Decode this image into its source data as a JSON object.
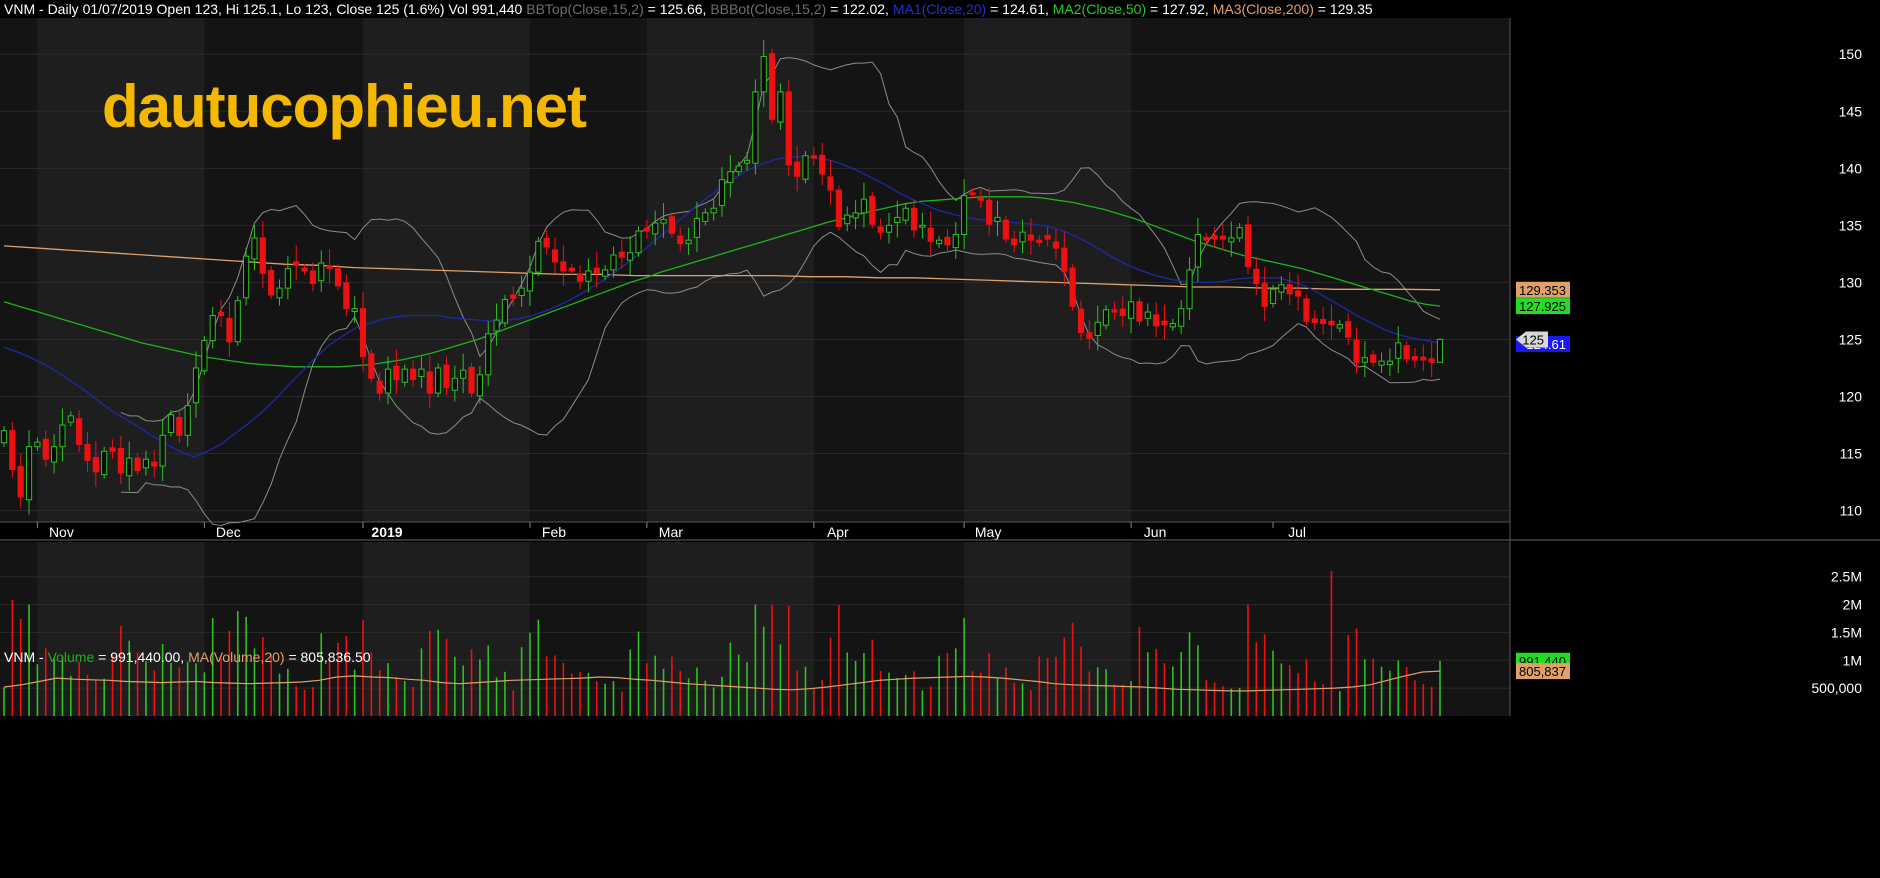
{
  "header": {
    "symbol": "VNM - ",
    "ohlc": "Daily 01/07/2019 Open 123, Hi 125.1, Lo 123, Close 125 (1.6%) Vol 991,440 ",
    "bbtop_label": "BBTop(Close,15,2)",
    "bbtop_value": " = 125.66, ",
    "bbbot_label": "BBBot(Close,15,2)",
    "bbbot_value": " = 122.02, ",
    "ma1_label": "MA1(Close,20)",
    "ma1_value": " = 124.61, ",
    "ma2_label": "MA2(Close,50)",
    "ma2_value": " = 127.92, ",
    "ma3_label": "MA3(Close,200)",
    "ma3_value": " = 129.35"
  },
  "volume_header": {
    "symbol": "VNM - ",
    "vol_label": "Volume",
    "vol_value": " = 991,440.00, ",
    "ma_label": "MA(Volume,20)",
    "ma_value": " = 805,836.50"
  },
  "watermark": "dautucophieu.net",
  "colors": {
    "background": "#000000",
    "panel_dark": "#141414",
    "panel_light": "#1e1e1e",
    "grid": "#2a2a2a",
    "up": "#2cc21f",
    "down": "#ee1111",
    "bollinger": "#8c8c8c",
    "ma20": "#1c2aa8",
    "ma50": "#1fb21f",
    "ma200": "#e0a06a",
    "watermark": "#f5b800",
    "header_gray": "#6e6e6e"
  },
  "chart_data": [
    {
      "type": "candlestick",
      "title": "VNM - Daily 01/07/2019 Open 123, Hi 125.1, Lo 123, Close 125 (1.6%) Vol 991,440",
      "ylim": [
        109,
        153
      ],
      "y_ticks": [
        110,
        115,
        120,
        125,
        130,
        135,
        140,
        145,
        150
      ],
      "x_ticks": [
        "Nov",
        "Dec",
        "2019",
        "Feb",
        "Mar",
        "Apr",
        "May",
        "Jun",
        "Jul"
      ],
      "x_tick_index": [
        4,
        24,
        43,
        63,
        77,
        97,
        115,
        135,
        152
      ],
      "closes": [
        117,
        113.6,
        111.2,
        115.6,
        116,
        114.5,
        115.6,
        117.5,
        118.3,
        115.8,
        114.4,
        113.4,
        115.2,
        115.2,
        113.3,
        114.6,
        113.5,
        114.5,
        113.9,
        116.6,
        118.4,
        116.6,
        119.2,
        122.5,
        124.9,
        127.1,
        127.1,
        124.8,
        128.4,
        132.3,
        133.9,
        130.8,
        128.9,
        129.5,
        131.2,
        131.5,
        131,
        129.9,
        131.7,
        131.2,
        129.7,
        127.7,
        127.7,
        123.5,
        121.6,
        120.3,
        122.4,
        121.5,
        122.4,
        121.5,
        122.4,
        120.3,
        122.5,
        120.8,
        121.6,
        122.3,
        120.3,
        121.9,
        125.5,
        126.7,
        128.5,
        128.6,
        129.5,
        130.9,
        133.6,
        133.1,
        131.8,
        131,
        131,
        130.1,
        131,
        130.8,
        131.1,
        132.4,
        132.2,
        132.6,
        134.5,
        134.5,
        135.2,
        135.5,
        134.3,
        133.4,
        133.7,
        135.6,
        136.1,
        136.5,
        139,
        139.7,
        140.2,
        140.7,
        146.7,
        149.8,
        144.3,
        146.7,
        140.3,
        139.3,
        141.1,
        140.9,
        139.5,
        138.1,
        134.9,
        135.9,
        136.1,
        137.3,
        135.1,
        134.4,
        135,
        135.7,
        136.5,
        134.6,
        135,
        133.6,
        133.7,
        133.3,
        134.2,
        137.6,
        137.7,
        137.2,
        135.1,
        135.7,
        133.8,
        133.3,
        134.4,
        133.7,
        133.5,
        133.8,
        133,
        131,
        127.9,
        125.6,
        125.1,
        126.5,
        127.6,
        127.4,
        127.1,
        128.3,
        126.6,
        127.4,
        126.2,
        126.3,
        126.4,
        127.7,
        131.1,
        134.2,
        133.7,
        133.8,
        133.8,
        133.9,
        134.8,
        131.4,
        129.9,
        127.9,
        129.4,
        129.8,
        129,
        128.8,
        126.6,
        126.5,
        126.4,
        126.3,
        126.3,
        125.2,
        123,
        123.4,
        123,
        123.1,
        123.1,
        124.7,
        123.3,
        123.2,
        123.2,
        123,
        125
      ],
      "ma20": [
        124.3,
        123.9,
        123.4,
        122.8,
        122.1,
        121.3,
        120.5,
        119.6,
        118.7,
        118,
        117.3,
        116.5,
        115.8,
        115.2,
        114.7,
        115.2,
        115.8,
        116.7,
        117.6,
        118.6,
        119.7,
        121,
        122.2,
        123.4,
        124.5,
        125.3,
        126,
        126.4,
        126.8,
        127,
        127.1,
        127.1,
        127.1,
        126.9,
        126.8,
        126.7,
        126.6,
        126.7,
        126.8,
        127.1,
        127.5,
        128,
        128.6,
        129.3,
        130,
        130.8,
        131.7,
        132.6,
        133.6,
        134.6,
        135.6,
        136.6,
        137.5,
        138.4,
        139.2,
        139.9,
        140.4,
        140.8,
        141,
        141,
        140.9,
        140.7,
        140.3,
        139.8,
        139.2,
        138.6,
        137.9,
        137.3,
        136.8,
        136.3,
        136,
        135.7,
        135.5,
        135.4,
        135.3,
        135.2,
        135.1,
        134.9,
        134.6,
        134.1,
        133.5,
        132.8,
        132.1,
        131.5,
        131,
        130.6,
        130.3,
        130.1,
        130,
        130,
        130.1,
        130.3,
        130.4,
        130.4,
        130.4,
        130.1,
        129.7,
        129.1,
        128.4,
        127.7,
        127,
        126.4,
        125.8,
        125.4,
        125.1,
        124.9,
        124.7
      ],
      "ma50": [
        128.3,
        127.9,
        127.5,
        127.1,
        126.7,
        126.3,
        125.9,
        125.5,
        125.1,
        124.7,
        124.4,
        124.1,
        123.8,
        123.5,
        123.3,
        123.1,
        122.9,
        122.8,
        122.7,
        122.6,
        122.6,
        122.6,
        122.6,
        122.7,
        122.8,
        123,
        123.2,
        123.5,
        123.8,
        124.2,
        124.6,
        125,
        125.5,
        126,
        126.5,
        127,
        127.5,
        128,
        128.5,
        129,
        129.5,
        130,
        130.4,
        130.9,
        131.3,
        131.7,
        132.1,
        132.5,
        132.9,
        133.3,
        133.7,
        134.1,
        134.5,
        134.9,
        135.3,
        135.6,
        136,
        136.3,
        136.6,
        136.9,
        137.1,
        137.2,
        137.3,
        137.4,
        137.5,
        137.5,
        137.5,
        137.5,
        137.4,
        137.2,
        137,
        136.7,
        136.4,
        136,
        135.6,
        135.1,
        134.6,
        134.1,
        133.6,
        133.2,
        132.8,
        132.4,
        132.1,
        131.8,
        131.5,
        131.2,
        130.8,
        130.4,
        130,
        129.6,
        129.2,
        128.8,
        128.4,
        128.1,
        127.92
      ],
      "ma200": [
        133.2,
        133,
        132.8,
        132.6,
        132.4,
        132.2,
        132,
        131.8,
        131.6,
        131.5,
        131.3,
        131.2,
        131.1,
        131,
        130.9,
        130.8,
        130.7,
        130.7,
        130.6,
        130.6,
        130.6,
        130.6,
        130.6,
        130.5,
        130.5,
        130.4,
        130.4,
        130.3,
        130.2,
        130.1,
        130,
        129.9,
        129.8,
        129.7,
        129.6,
        129.6,
        129.5,
        129.5,
        129.4,
        129.4,
        129.4,
        129.35
      ],
      "last_labels": {
        "close": "125",
        "ma200": "129.353",
        "ma50": "127.925",
        "ma20": "124.61"
      }
    },
    {
      "type": "bar",
      "title": "VNM - Volume = 991,440.00, MA(Volume,20) = 805,836.50",
      "ylim": [
        0,
        2800000
      ],
      "y_ticks": [
        "500,000",
        "1M",
        "1.5M",
        "2M",
        "2.5M"
      ],
      "y_tick_values": [
        500000,
        1000000,
        1500000,
        2000000,
        2500000
      ],
      "ma_volume_approx": [
        520000,
        560000,
        620000,
        680000,
        660000,
        650000,
        640000,
        620000,
        610000,
        600000,
        610000,
        620000,
        600000,
        590000,
        580000,
        590000,
        600000,
        610000,
        640000,
        700000,
        720000,
        700000,
        690000,
        660000,
        640000,
        600000,
        580000,
        600000,
        620000,
        640000,
        650000,
        660000,
        670000,
        680000,
        700000,
        690000,
        660000,
        640000,
        610000,
        580000,
        560000,
        540000,
        520000,
        500000,
        480000,
        470000,
        490000,
        520000,
        560000,
        600000,
        640000,
        660000,
        680000,
        690000,
        700000,
        710000,
        700000,
        680000,
        650000,
        620000,
        580000,
        560000,
        550000,
        540000,
        530000,
        520000,
        500000,
        480000,
        470000,
        460000,
        450000,
        450000,
        460000,
        470000,
        480000,
        490000,
        500000,
        520000,
        560000,
        640000,
        720000,
        790000,
        805836
      ],
      "last_labels": {
        "volume": "991,440",
        "ma": "805,837"
      }
    }
  ]
}
